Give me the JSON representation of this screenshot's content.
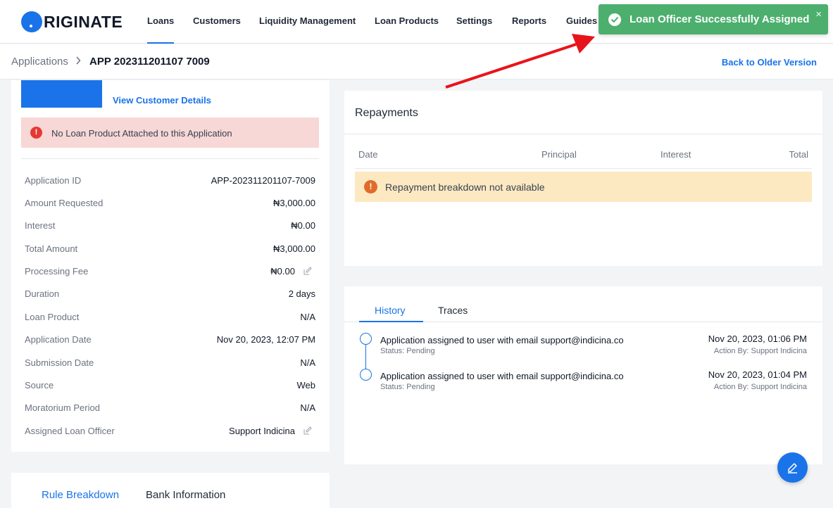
{
  "nav": {
    "logo_text": "RIGINATE",
    "items": [
      "Loans",
      "Customers",
      "Liquidity Management",
      "Loan Products",
      "Settings",
      "Reports",
      "Guides"
    ],
    "active": "Loans"
  },
  "toast": {
    "message": "Loan Officer Successfully Assigned",
    "close": "×",
    "color": "#4caf6e"
  },
  "breadcrumb": {
    "parent": "Applications",
    "current": "APP 202311201107 7009",
    "back_link": "Back to Older Version"
  },
  "customer": {
    "view_details": "View Customer Details"
  },
  "alert_no_product": {
    "icon": "!",
    "text": "No Loan Product Attached to this Application"
  },
  "details": [
    {
      "label": "Application ID",
      "value": "APP-202311201107-7009"
    },
    {
      "label": "Amount Requested",
      "value": "₦3,000.00"
    },
    {
      "label": "Interest",
      "value": "₦0.00"
    },
    {
      "label": "Total Amount",
      "value": "₦3,000.00"
    },
    {
      "label": "Processing Fee",
      "value": "₦0.00"
    },
    {
      "label": "Duration",
      "value": "2 days"
    },
    {
      "label": "Loan Product",
      "value": "N/A"
    },
    {
      "label": "Application Date",
      "value": "Nov 20, 2023, 12:07 PM"
    },
    {
      "label": "Submission Date",
      "value": "N/A"
    },
    {
      "label": "Source",
      "value": "Web"
    },
    {
      "label": "Moratorium Period",
      "value": "N/A"
    },
    {
      "label": "Assigned Loan Officer",
      "value": "Support Indicina"
    }
  ],
  "left_tabs": [
    "Rule Breakdown",
    "Bank Information"
  ],
  "repayments": {
    "title": "Repayments",
    "columns": [
      "Date",
      "Principal",
      "Interest",
      "Total"
    ],
    "empty_icon": "!",
    "empty_text": "Repayment breakdown not available"
  },
  "history": {
    "tabs": [
      "History",
      "Traces"
    ],
    "events": [
      {
        "title": "Application assigned to user with email support@indicina.co",
        "status": "Status: Pending",
        "time": "Nov 20, 2023, 01:06 PM",
        "by": "Action By: Support Indicina"
      },
      {
        "title": "Application assigned to user with email support@indicina.co",
        "status": "Status: Pending",
        "time": "Nov 20, 2023, 01:04 PM",
        "by": "Action By: Support Indicina"
      }
    ]
  },
  "colors": {
    "accent": "#1a73e8",
    "error_bg": "#f8d7d7",
    "warn_bg": "#fde9c1",
    "annotation_arrow": "#e8141b"
  }
}
